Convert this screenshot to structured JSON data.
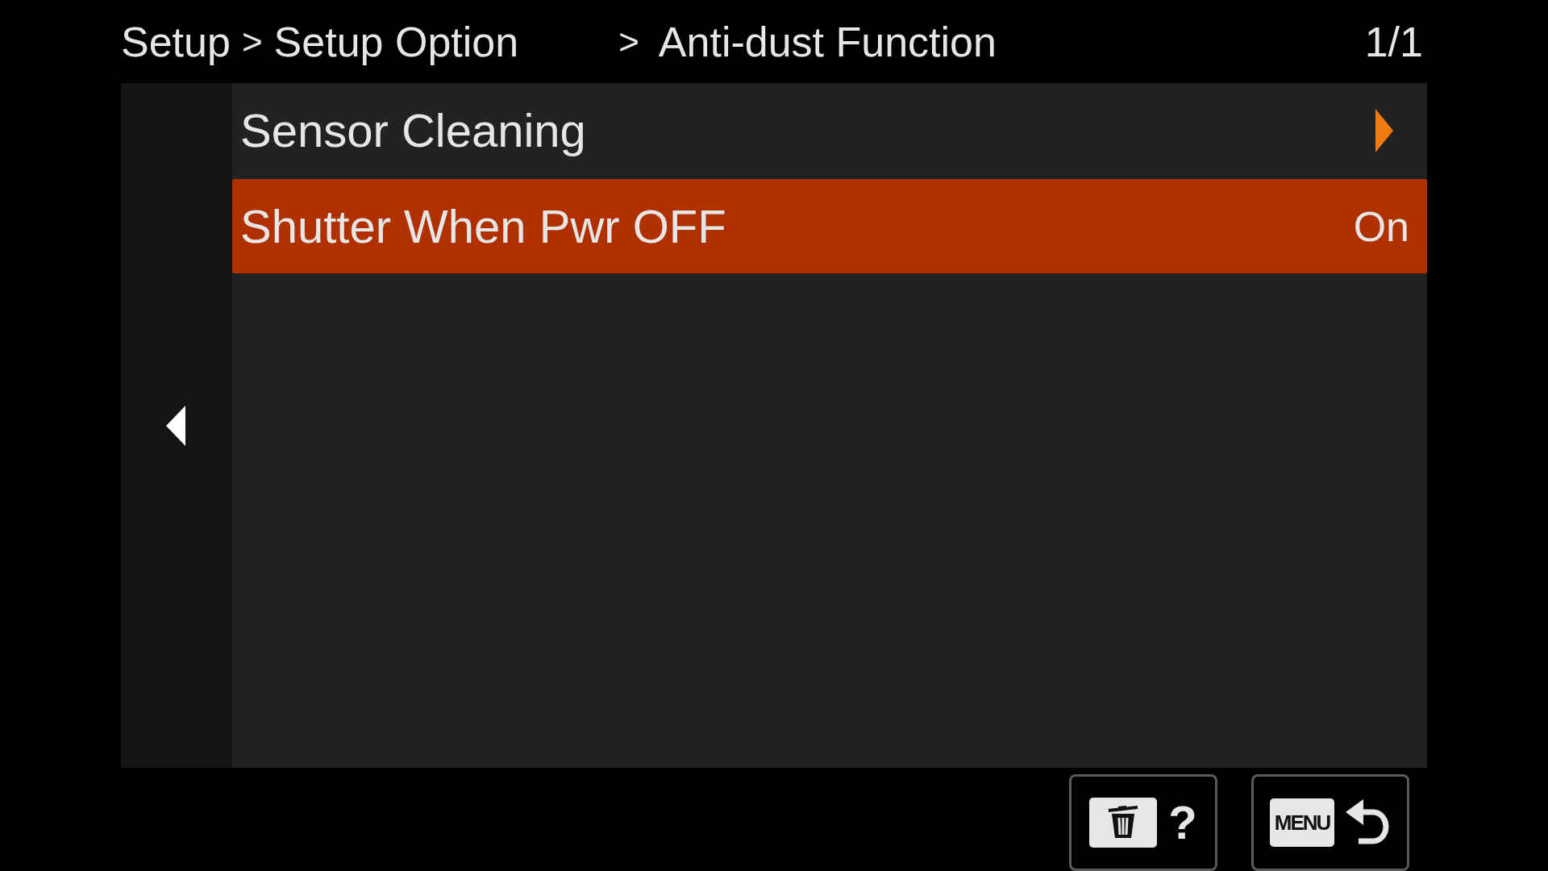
{
  "breadcrumb": [
    {
      "label": "Setup",
      "separator": ">"
    },
    {
      "label": "Setup Option",
      "separator": ">"
    },
    {
      "label": "Anti-dust Function"
    }
  ],
  "page": "1/1",
  "rows": [
    {
      "kind": "submenu",
      "label": "Sensor Cleaning",
      "selected": false
    },
    {
      "kind": "value",
      "label": "Shutter When Pwr OFF",
      "value": "On",
      "selected": true
    }
  ],
  "buttons": [
    {
      "kind": "help",
      "label": "?"
    },
    {
      "kind": "back",
      "label": "MENU"
    }
  ]
}
